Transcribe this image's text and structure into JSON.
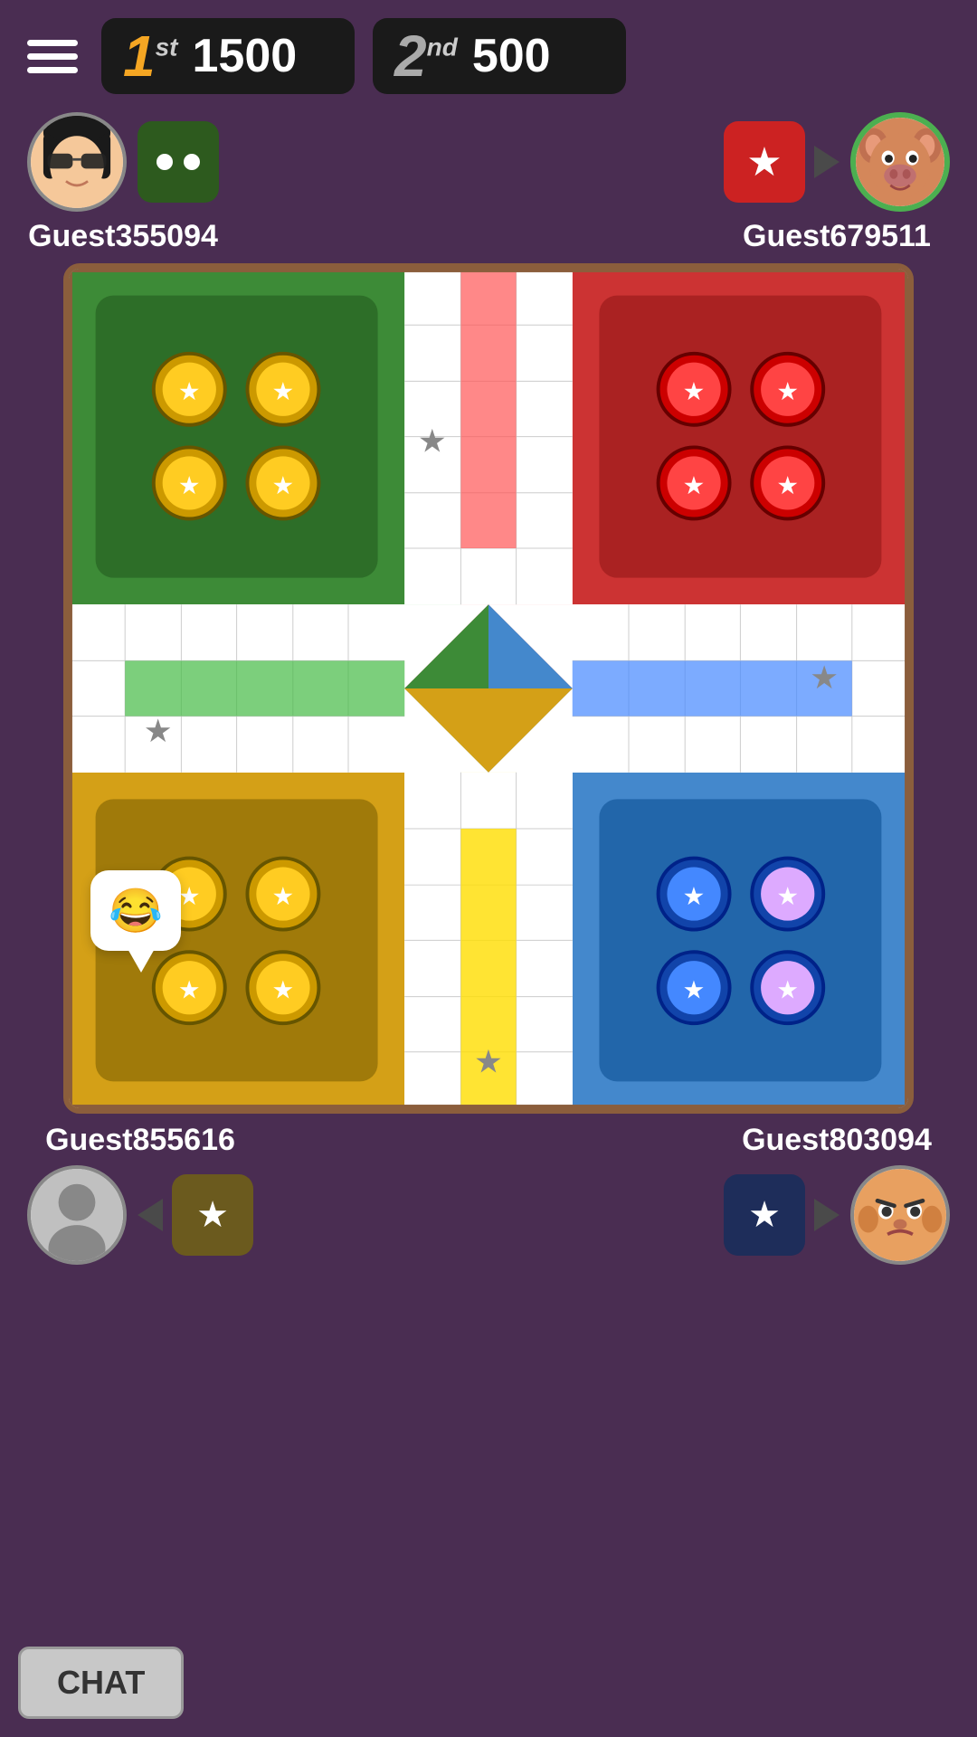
{
  "header": {
    "menu_label": "menu",
    "scores": [
      {
        "rank": "1",
        "rank_suffix": "st",
        "value": "1500"
      },
      {
        "rank": "2",
        "rank_suffix": "nd",
        "value": "500"
      }
    ]
  },
  "players": [
    {
      "name": "Guest355094",
      "position": "top-left",
      "color": "green",
      "avatar": "woman",
      "active": false
    },
    {
      "name": "Guest679511",
      "position": "top-right",
      "color": "red",
      "avatar": "pig",
      "active": true
    },
    {
      "name": "Guest855616",
      "position": "bottom-left",
      "color": "yellow",
      "avatar": "default",
      "active": false
    },
    {
      "name": "Guest803094",
      "position": "bottom-right",
      "color": "blue",
      "avatar": "bald",
      "active": false
    }
  ],
  "chat": {
    "button_label": "CHAT",
    "emoji": "😂"
  },
  "board": {
    "size": 15,
    "token_icon": "⭐"
  }
}
